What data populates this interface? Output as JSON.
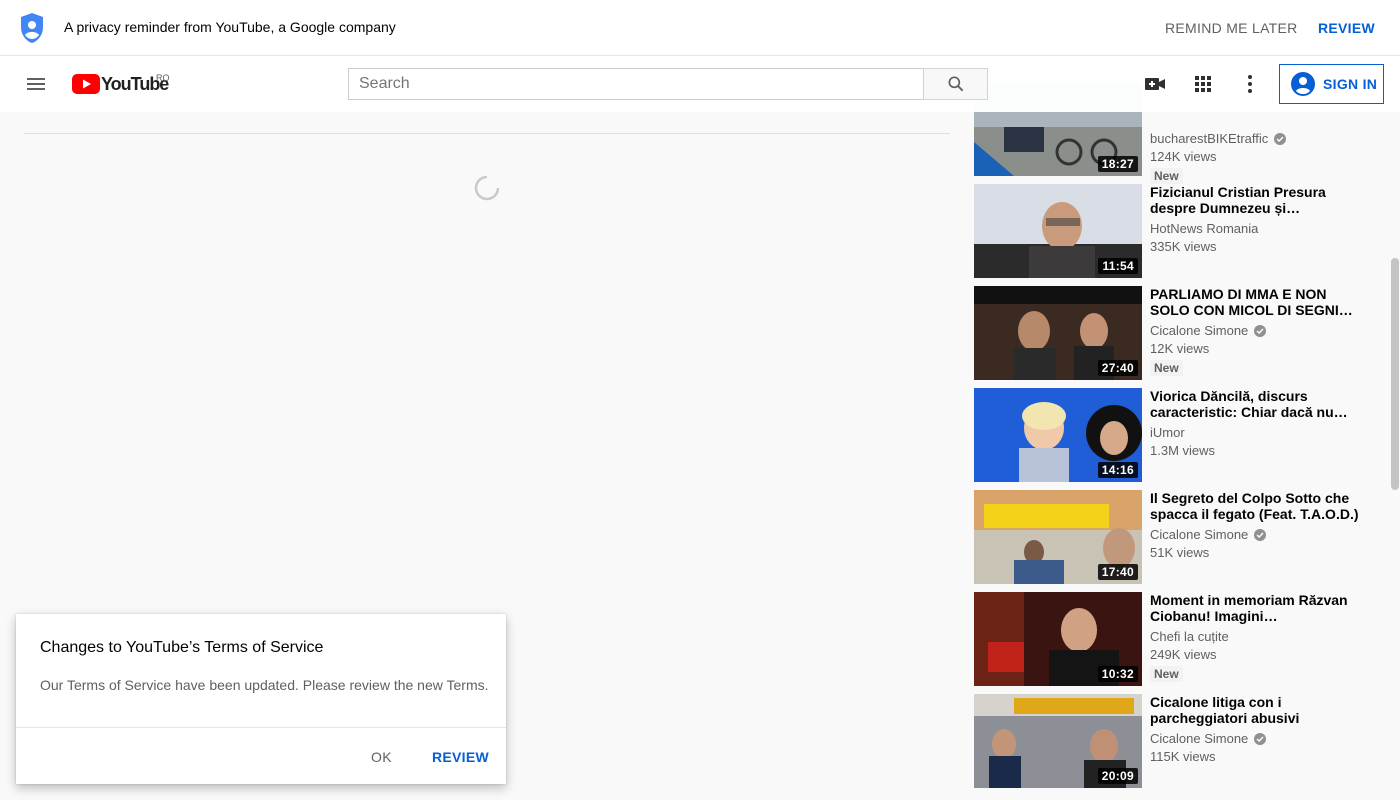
{
  "privacy_banner": {
    "text": "A privacy reminder from YouTube, a Google company",
    "remind_label": "REMIND ME LATER",
    "review_label": "REVIEW",
    "icon": "shield-person-icon"
  },
  "masthead": {
    "logo_text": "YouTube",
    "country_code": "RO",
    "search_placeholder": "Search",
    "sign_in_label": "SIGN IN",
    "icons": [
      "menu-icon",
      "search-icon",
      "create-video-icon",
      "apps-grid-icon",
      "more-vert-icon",
      "account-icon"
    ]
  },
  "sidebar": {
    "videos": [
      {
        "title": "",
        "channel": "bucharestBIKEtraffic",
        "verified": true,
        "views": "124K views",
        "badge": "New",
        "duration": "18:27"
      },
      {
        "title": "Fizicianul Cristian Presura despre Dumnezeu și…",
        "channel": "HotNews Romania",
        "verified": false,
        "views": "335K views",
        "badge": "",
        "duration": "11:54"
      },
      {
        "title": "PARLIAMO DI MMA E NON SOLO CON MICOL DI SEGNI…",
        "channel": "Cicalone Simone",
        "verified": true,
        "views": "12K views",
        "badge": "New",
        "duration": "27:40"
      },
      {
        "title": "Viorica Dăncilă, discurs caracteristic: Chiar dacă nu…",
        "channel": "iUmor",
        "verified": false,
        "views": "1.3M views",
        "badge": "",
        "duration": "14:16"
      },
      {
        "title": "Il Segreto del Colpo Sotto che spacca il fegato (Feat. T.A.O.D.)",
        "channel": "Cicalone Simone",
        "verified": true,
        "views": "51K views",
        "badge": "",
        "duration": "17:40"
      },
      {
        "title": "Moment in memoriam Răzvan Ciobanu! Imagini emoționante…",
        "channel": "Chefi la cuțite",
        "verified": false,
        "views": "249K views",
        "badge": "New",
        "duration": "10:32"
      },
      {
        "title": "Cicalone litiga con i parcheggiatori abusivi",
        "channel": "Cicalone Simone",
        "verified": true,
        "views": "115K views",
        "badge": "",
        "duration": "20:09"
      }
    ]
  },
  "toast": {
    "title": "Changes to YouTube’s Terms of Service",
    "body": "Our Terms of Service have been updated. Please review the new Terms.",
    "ok_label": "OK",
    "review_label": "REVIEW"
  },
  "colors": {
    "accent": "#065fd4",
    "brand_red": "#ff0000",
    "background": "#f9f9f9"
  }
}
